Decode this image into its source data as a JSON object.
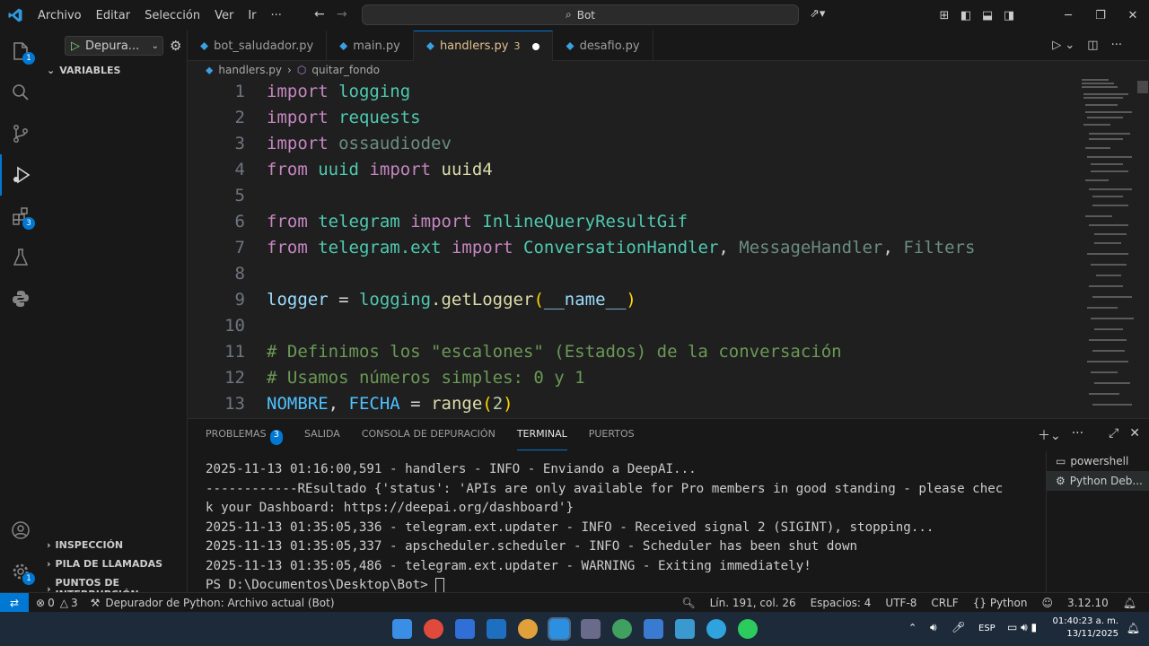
{
  "titlebar": {
    "menu": [
      "Archivo",
      "Editar",
      "Selección",
      "Ver",
      "Ir",
      "···"
    ],
    "search": "Bot"
  },
  "activity": {
    "explorer_badge": "1",
    "extensions_badge": "3",
    "settings_badge": "1"
  },
  "debug": {
    "config_label": "Depura..."
  },
  "sidebar": {
    "variables": "VARIABLES",
    "inspection": "INSPECCIÓN",
    "call_stack": "PILA DE LLAMADAS",
    "breakpoints": "PUNTOS DE INTERRUPCIÓN"
  },
  "tabs": [
    {
      "label": "bot_saludador.py"
    },
    {
      "label": "main.py"
    },
    {
      "label": "handlers.py",
      "problems": "3"
    },
    {
      "label": "desafio.py"
    }
  ],
  "breadcrumb": {
    "file": "handlers.py",
    "symbol": "quitar_fondo"
  },
  "editor": {
    "line_numbers": [
      "1",
      "2",
      "3",
      "4",
      "5",
      "6",
      "7",
      "8",
      "9",
      "10",
      "11",
      "12",
      "13"
    ],
    "l1": {
      "kw": "import",
      "mod": "logging"
    },
    "l2": {
      "kw": "import",
      "mod": "requests"
    },
    "l3": {
      "kw": "import",
      "mod": "ossaudiodev"
    },
    "l4": {
      "kw1": "from",
      "mod": "uuid",
      "kw2": "import",
      "name": "uuid4"
    },
    "l6": {
      "kw1": "from",
      "mod": "telegram",
      "kw2": "import",
      "name": "InlineQueryResultGif"
    },
    "l7": {
      "kw1": "from",
      "mod": "telegram.ext",
      "kw2": "import",
      "n1": "ConversationHandler",
      "n2": "MessageHandler",
      "n3": "Filters"
    },
    "l9": {
      "var": "logger",
      "eq": " = ",
      "mod": "logging",
      "fn": ".getLogger",
      "arg": "__name__"
    },
    "l11": "# Definimos los \"escalones\" (Estados) de la conversación",
    "l12": "# Usamos números simples: 0 y 1",
    "l13": {
      "c1": "NOMBRE",
      "c2": "FECHA",
      "fn": "range",
      "num": "2"
    }
  },
  "panel": {
    "tabs": [
      "PROBLEMAS",
      "SALIDA",
      "CONSOLA DE DEPURACIÓN",
      "TERMINAL",
      "PUERTOS"
    ],
    "problems_count": "3",
    "terminals": [
      "powershell",
      "Python Deb..."
    ],
    "terminal_lines": [
      "2025-11-13 01:16:00,591 - handlers - INFO - Enviando a DeepAI...",
      "------------REsultado {'status': 'APIs are only available for Pro members in good standing - please chec",
      "k your Dashboard: https://deepai.org/dashboard'}",
      "2025-11-13 01:35:05,336 - telegram.ext.updater - INFO - Received signal 2 (SIGINT), stopping...",
      "2025-11-13 01:35:05,337 - apscheduler.scheduler - INFO - Scheduler has been shut down",
      "2025-11-13 01:35:05,486 - telegram.ext.updater - WARNING - Exiting immediately!",
      "PS D:\\Documentos\\Desktop\\Bot> "
    ]
  },
  "status": {
    "errors": "0",
    "warnings": "3",
    "debug": "Depurador de Python: Archivo actual (Bot)",
    "position": "Lín. 191, col. 26",
    "spaces": "Espacios: 4",
    "encoding": "UTF-8",
    "eol": "CRLF",
    "language": "Python",
    "version": "3.12.10"
  },
  "taskbar": {
    "lang": "ESP",
    "time": "01:40:23 a. m.",
    "date": "13/11/2025"
  }
}
